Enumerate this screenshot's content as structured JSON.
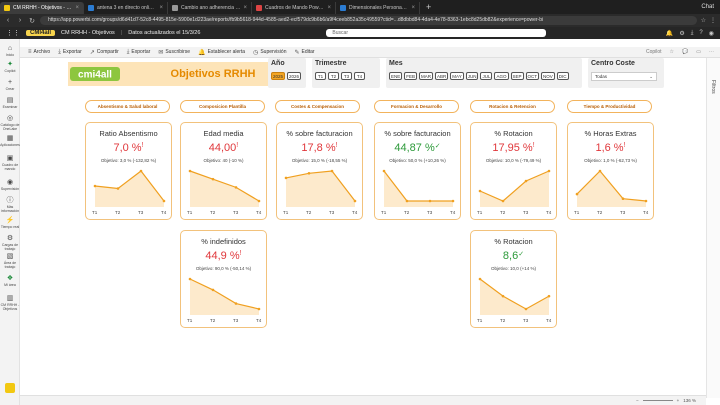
{
  "browser": {
    "tabs": [
      {
        "label": "CM RRHH - Objetivos - Power BI",
        "active": true,
        "fav": "yellow"
      },
      {
        "label": "antena 3 en directo online - Busc",
        "active": false,
        "fav": "blue"
      },
      {
        "label": "Cambio ano adherencia seconov",
        "active": false,
        "fav": "grey"
      },
      {
        "label": "Cuadros de Mando Power BI",
        "active": false,
        "fav": "red"
      },
      {
        "label": "Dimensionales Personas | Sitio",
        "active": false,
        "fav": "blue"
      }
    ],
    "new_tab": "+",
    "chat": "Chat",
    "url": "https://app.powerbi.com/groups/d6d41d7-52c8-4495-815e-5900e1d223ae/reports/fb9b5618-944d-4585-aed2-ecf579dc9b6b6/a9f4ceeb852a35c49559?ctid=...d8dbbd84-4da4-4e78-8363-1ebc8d25db82&experience=power-bi"
  },
  "pbi_header": {
    "brand": "CMI4all",
    "report_name": "CM RRHH - Objetivos",
    "updated": "Datos actualizados el 15/3/26",
    "search_placeholder": "Buscar"
  },
  "toolbar": {
    "items": [
      "Archivo",
      "Exportar",
      "Compartir",
      "Exportar",
      "Suscribirse",
      "Establecer alerta",
      "Supervisión",
      "Editar"
    ],
    "right": [
      "Copilot"
    ]
  },
  "rail": {
    "items": [
      "Inicio",
      "Copilot",
      "Crear",
      "Examinar",
      "Catálogo de OneLake",
      "Aplicaciones",
      "Cuadro de mando",
      "Supervisión",
      "Más información",
      "Tiempo real",
      "Cargas de trabajo",
      "Área de trabajo",
      "Mi área",
      "CM RRHH - Objetivos"
    ]
  },
  "filters_pane_label": "Filtros",
  "report": {
    "logo_text": "cmi4all",
    "title": "Objetivos RRHH",
    "filters": {
      "anio": {
        "label": "Año",
        "options": [
          "2025",
          "2026"
        ],
        "selected": "2025"
      },
      "trimestre": {
        "label": "Trimestre",
        "options": [
          "T1",
          "T2",
          "T3",
          "T4"
        ]
      },
      "mes": {
        "label": "Mes",
        "options": [
          "ENE",
          "FEB",
          "MAR",
          "ABR",
          "MAY",
          "JUN",
          "JUL",
          "AGO",
          "SEP",
          "OCT",
          "NOV",
          "DIC"
        ]
      },
      "centro": {
        "label": "Centro Coste",
        "value": "Todas"
      }
    },
    "categories": [
      "Absentismo & Salud laboral",
      "Composicion Plantilla",
      "Costes & Compensacion",
      "Formacion & Desarrollo",
      "Rotacion & Retencion",
      "Tiempo & Productividad"
    ],
    "quarters": [
      "T1",
      "T2",
      "T3",
      "T4"
    ],
    "kpis": [
      {
        "title": "Ratio Absentismo",
        "value": "7,0 %",
        "status": "red",
        "indicator": "!",
        "objective": "Objetivo: 3,0 % (-132,82 %)",
        "series": [
          32,
          30,
          44,
          20
        ]
      },
      {
        "title": "Edad media",
        "value": "44,00",
        "status": "red",
        "indicator": "!",
        "objective": "Objetivo: 40 (-10 %)",
        "series": [
          44.8,
          44.2,
          43.6,
          42.6
        ]
      },
      {
        "title": "% sobre facturacion",
        "value": "17,8 %",
        "status": "red",
        "indicator": "!",
        "objective": "Objetivo: 15,0 % (-18,55 %)",
        "series": [
          17.9,
          18.1,
          18.2,
          16.9
        ]
      },
      {
        "title": "% sobre facturacion",
        "value": "44,87 %",
        "status": "green",
        "indicator": "✓",
        "objective": "Objetivo: 50,0 % (+10,26 %)",
        "series": [
          80,
          42,
          42,
          42
        ]
      },
      {
        "title": "% Rotacion",
        "value": "17,95 %",
        "status": "red",
        "indicator": "!",
        "objective": "Objetivo: 10,0 % (-79,49 %)",
        "series": [
          16,
          13,
          19,
          22
        ]
      },
      {
        "title": "% Horas Extras",
        "value": "1,6 %",
        "status": "red",
        "indicator": "!",
        "objective": "Objetivo: 1,0 % (-62,73 %)",
        "series": [
          1.4,
          2.4,
          1.2,
          1.1
        ]
      },
      {
        "title": "% indefinidos",
        "value": "44,9 %",
        "status": "red",
        "indicator": "!",
        "objective": "Objetivo: 90,0 % (-50,14 %)",
        "series": [
          52,
          48,
          43,
          41
        ]
      },
      {
        "title": "% Rotacion",
        "value": "8,6",
        "status": "green",
        "indicator": "✓",
        "objective": "Objetivo: 10,0 (+14 %)",
        "series": [
          12,
          8,
          5,
          8
        ]
      }
    ]
  },
  "status": {
    "zoom": "136 %"
  }
}
